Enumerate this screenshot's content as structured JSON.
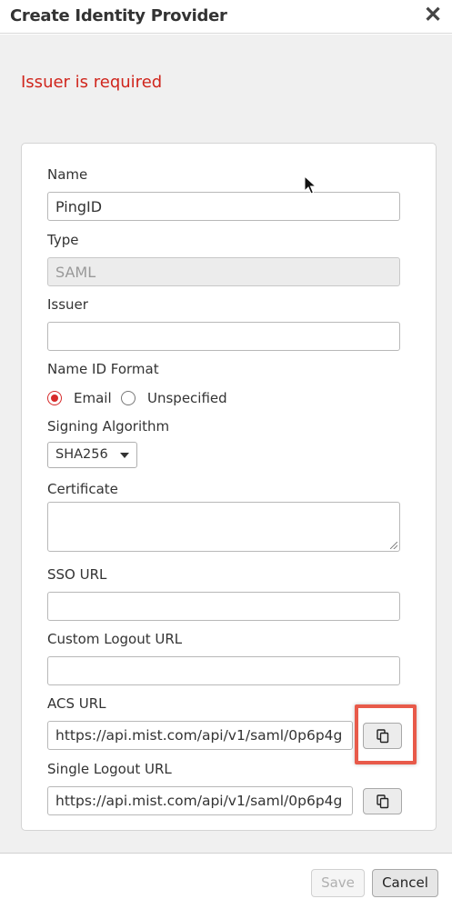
{
  "dialog": {
    "title": "Create Identity Provider",
    "close_icon": "close-icon",
    "error_message": "Issuer is required"
  },
  "form": {
    "name": {
      "label": "Name",
      "value": "PingID"
    },
    "type": {
      "label": "Type",
      "value": "SAML"
    },
    "issuer": {
      "label": "Issuer",
      "value": ""
    },
    "name_id_format": {
      "label": "Name ID Format",
      "options": [
        "Email",
        "Unspecified"
      ],
      "selected": "Email"
    },
    "signing_algorithm": {
      "label": "Signing Algorithm",
      "value": "SHA256"
    },
    "certificate": {
      "label": "Certificate",
      "value": ""
    },
    "sso_url": {
      "label": "SSO URL",
      "value": ""
    },
    "custom_logout_url": {
      "label": "Custom Logout URL",
      "value": ""
    },
    "acs_url": {
      "label": "ACS URL",
      "value": "https://api.mist.com/api/v1/saml/0p6p4g"
    },
    "single_logout_url": {
      "label": "Single Logout URL",
      "value": "https://api.mist.com/api/v1/saml/0p6p4g"
    }
  },
  "footer": {
    "save_label": "Save",
    "cancel_label": "Cancel"
  },
  "colors": {
    "error": "#d0261d",
    "highlight": "#e85a4a",
    "radio_accent": "#d62a2a"
  }
}
